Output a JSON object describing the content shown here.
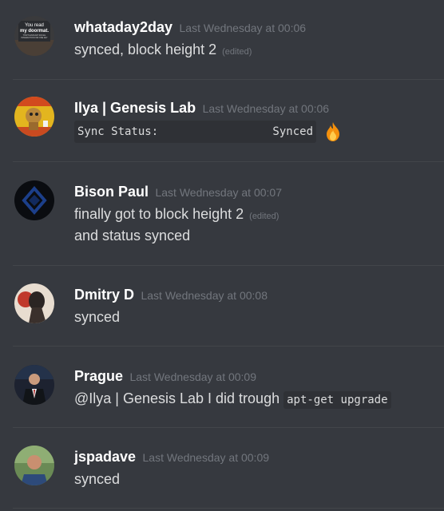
{
  "messages": [
    {
      "username": "whataday2day",
      "timestamp": "Last Wednesday at 00:06",
      "avatar_text": [
        "You read",
        "my doormat.",
        "THAT'S ENOUGH SOCIAL",
        "INTERACTION FOR ONE DAY"
      ],
      "line1": "synced, block height 2",
      "edited": "(edited)"
    },
    {
      "username": "Ilya | Genesis Lab",
      "timestamp": "Last Wednesday at 00:06",
      "code": "Sync Status:                 Synced",
      "emoji": "fire-emoji"
    },
    {
      "username": "Bison Paul",
      "timestamp": "Last Wednesday at 00:07",
      "line1": "finally got to block height 2",
      "edited": "(edited)",
      "line2": "and status synced"
    },
    {
      "username": "Dmitry D",
      "timestamp": "Last Wednesday at 00:08",
      "line1": "synced"
    },
    {
      "username": "Prague",
      "timestamp": "Last Wednesday at 00:09",
      "line1": "@Ilya | Genesis Lab I did trough",
      "code": "apt-get upgrade"
    },
    {
      "username": "jspadave",
      "timestamp": "Last Wednesday at 00:09",
      "line1": "synced"
    }
  ],
  "colors": {
    "background": "#36393f",
    "username": "#ffffff",
    "timestamp": "#72767d",
    "text": "#dcddde",
    "divider": "#42454a",
    "code_bg": "#2f3136"
  }
}
